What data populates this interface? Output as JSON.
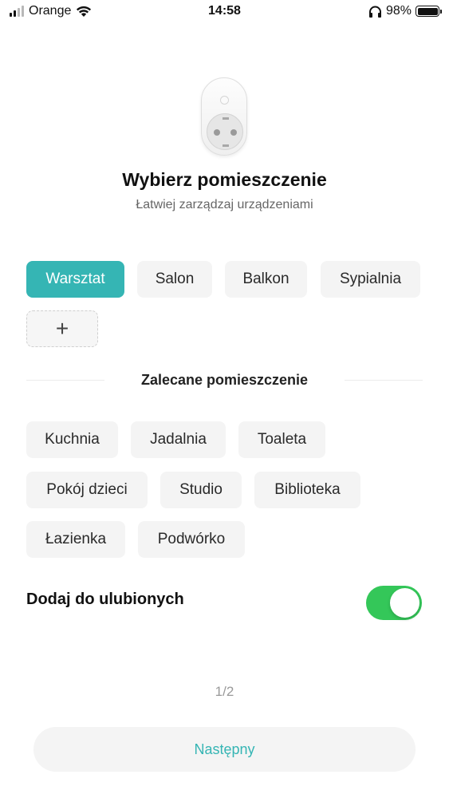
{
  "status_bar": {
    "carrier": "Orange",
    "time": "14:58",
    "battery": "98%"
  },
  "device": {
    "icon": "smart-plug-illustration"
  },
  "header": {
    "title": "Wybierz pomieszczenie",
    "subtitle": "Łatwiej zarządzaj urządzeniami"
  },
  "rooms": {
    "items": [
      {
        "label": "Warsztat",
        "selected": true
      },
      {
        "label": "Salon",
        "selected": false
      },
      {
        "label": "Balkon",
        "selected": false
      },
      {
        "label": "Sypialnia",
        "selected": false
      }
    ],
    "add_label": "+"
  },
  "recommended": {
    "title": "Zalecane pomieszczenie",
    "items": [
      "Kuchnia",
      "Jadalnia",
      "Toaleta",
      "Pokój dzieci",
      "Studio",
      "Biblioteka",
      "Łazienka",
      "Podwórko"
    ]
  },
  "favorites": {
    "label": "Dodaj do ulubionych",
    "enabled": true
  },
  "pager": "1/2",
  "next_button": "Następny",
  "colors": {
    "accent": "#35b5b4",
    "toggle_on": "#34c759"
  }
}
